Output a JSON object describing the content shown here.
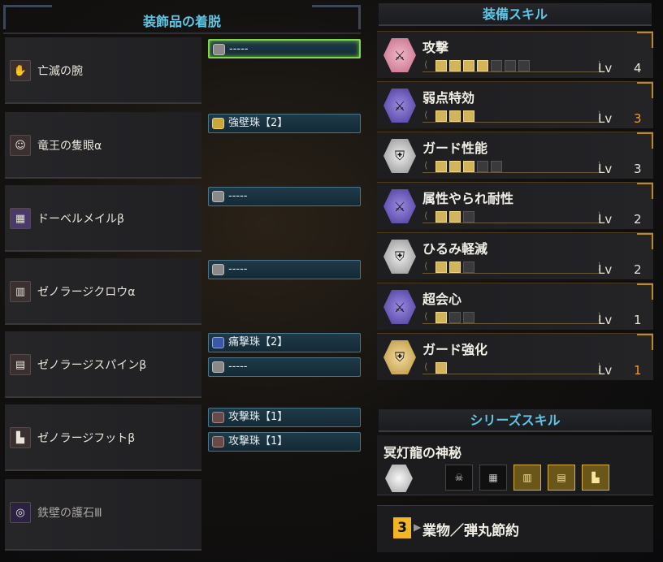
{
  "left": {
    "header": "装飾品の着脱",
    "equipment": [
      {
        "name": "亡滅の腕",
        "icon": "arm-armor-icon",
        "slots": [
          {
            "label": "-----",
            "icon": "empty-slot-lv1-icon",
            "active": true
          }
        ]
      },
      {
        "name": "竜王の隻眼α",
        "icon": "head-armor-icon",
        "slots": [
          {
            "label": "強壁珠【2】",
            "icon": "decoration-gold-icon"
          }
        ]
      },
      {
        "name": "ドーベルメイルβ",
        "icon": "chest-armor-icon",
        "slots": [
          {
            "label": "-----",
            "icon": "empty-slot-lv3-icon"
          }
        ]
      },
      {
        "name": "ゼノラージクロウα",
        "icon": "arm-armor-icon",
        "slots": [
          {
            "label": "-----",
            "icon": "empty-slot-lv1-icon"
          }
        ]
      },
      {
        "name": "ゼノラージスパインβ",
        "icon": "waist-armor-icon",
        "slots": [
          {
            "label": "痛撃珠【2】",
            "icon": "decoration-blue-icon"
          },
          {
            "label": "-----",
            "icon": "empty-slot-lv1-icon"
          }
        ]
      },
      {
        "name": "ゼノラージフットβ",
        "icon": "leg-armor-icon",
        "slots": [
          {
            "label": "攻撃珠【1】",
            "icon": "decoration-red-icon"
          },
          {
            "label": "攻撃珠【1】",
            "icon": "decoration-red-icon"
          }
        ]
      },
      {
        "name": "鉄壁の護石Ⅲ",
        "icon": "charm-icon",
        "slots": []
      }
    ]
  },
  "right": {
    "skills_header": "装備スキル",
    "lv_label": "Lv",
    "skills": [
      {
        "name": "攻撃",
        "level": "4",
        "max": 7,
        "color": "pink",
        "highlight": false
      },
      {
        "name": "弱点特効",
        "level": "3",
        "max": 3,
        "color": "purple",
        "highlight": true
      },
      {
        "name": "ガード性能",
        "level": "3",
        "max": 5,
        "color": "grey",
        "highlight": false
      },
      {
        "name": "属性やられ耐性",
        "level": "2",
        "max": 3,
        "color": "purple",
        "highlight": false
      },
      {
        "name": "ひるみ軽減",
        "level": "2",
        "max": 3,
        "color": "grey",
        "highlight": false
      },
      {
        "name": "超会心",
        "level": "1",
        "max": 3,
        "color": "purple",
        "highlight": false
      },
      {
        "name": "ガード強化",
        "level": "1",
        "max": 1,
        "color": "gold",
        "highlight": true
      }
    ],
    "series_header": "シリーズスキル",
    "series": {
      "name": "冥灯龍の神秘",
      "pieces_total": 6,
      "pieces_on": 3,
      "bonus_count": "3",
      "bonus_name": "業物／弾丸節約"
    }
  },
  "colors": {
    "accent_cyan": "#5fc6e6",
    "active_slot": "#7ed648",
    "level_orange": "#f09a28",
    "pip_gold": "#d2b45a"
  }
}
